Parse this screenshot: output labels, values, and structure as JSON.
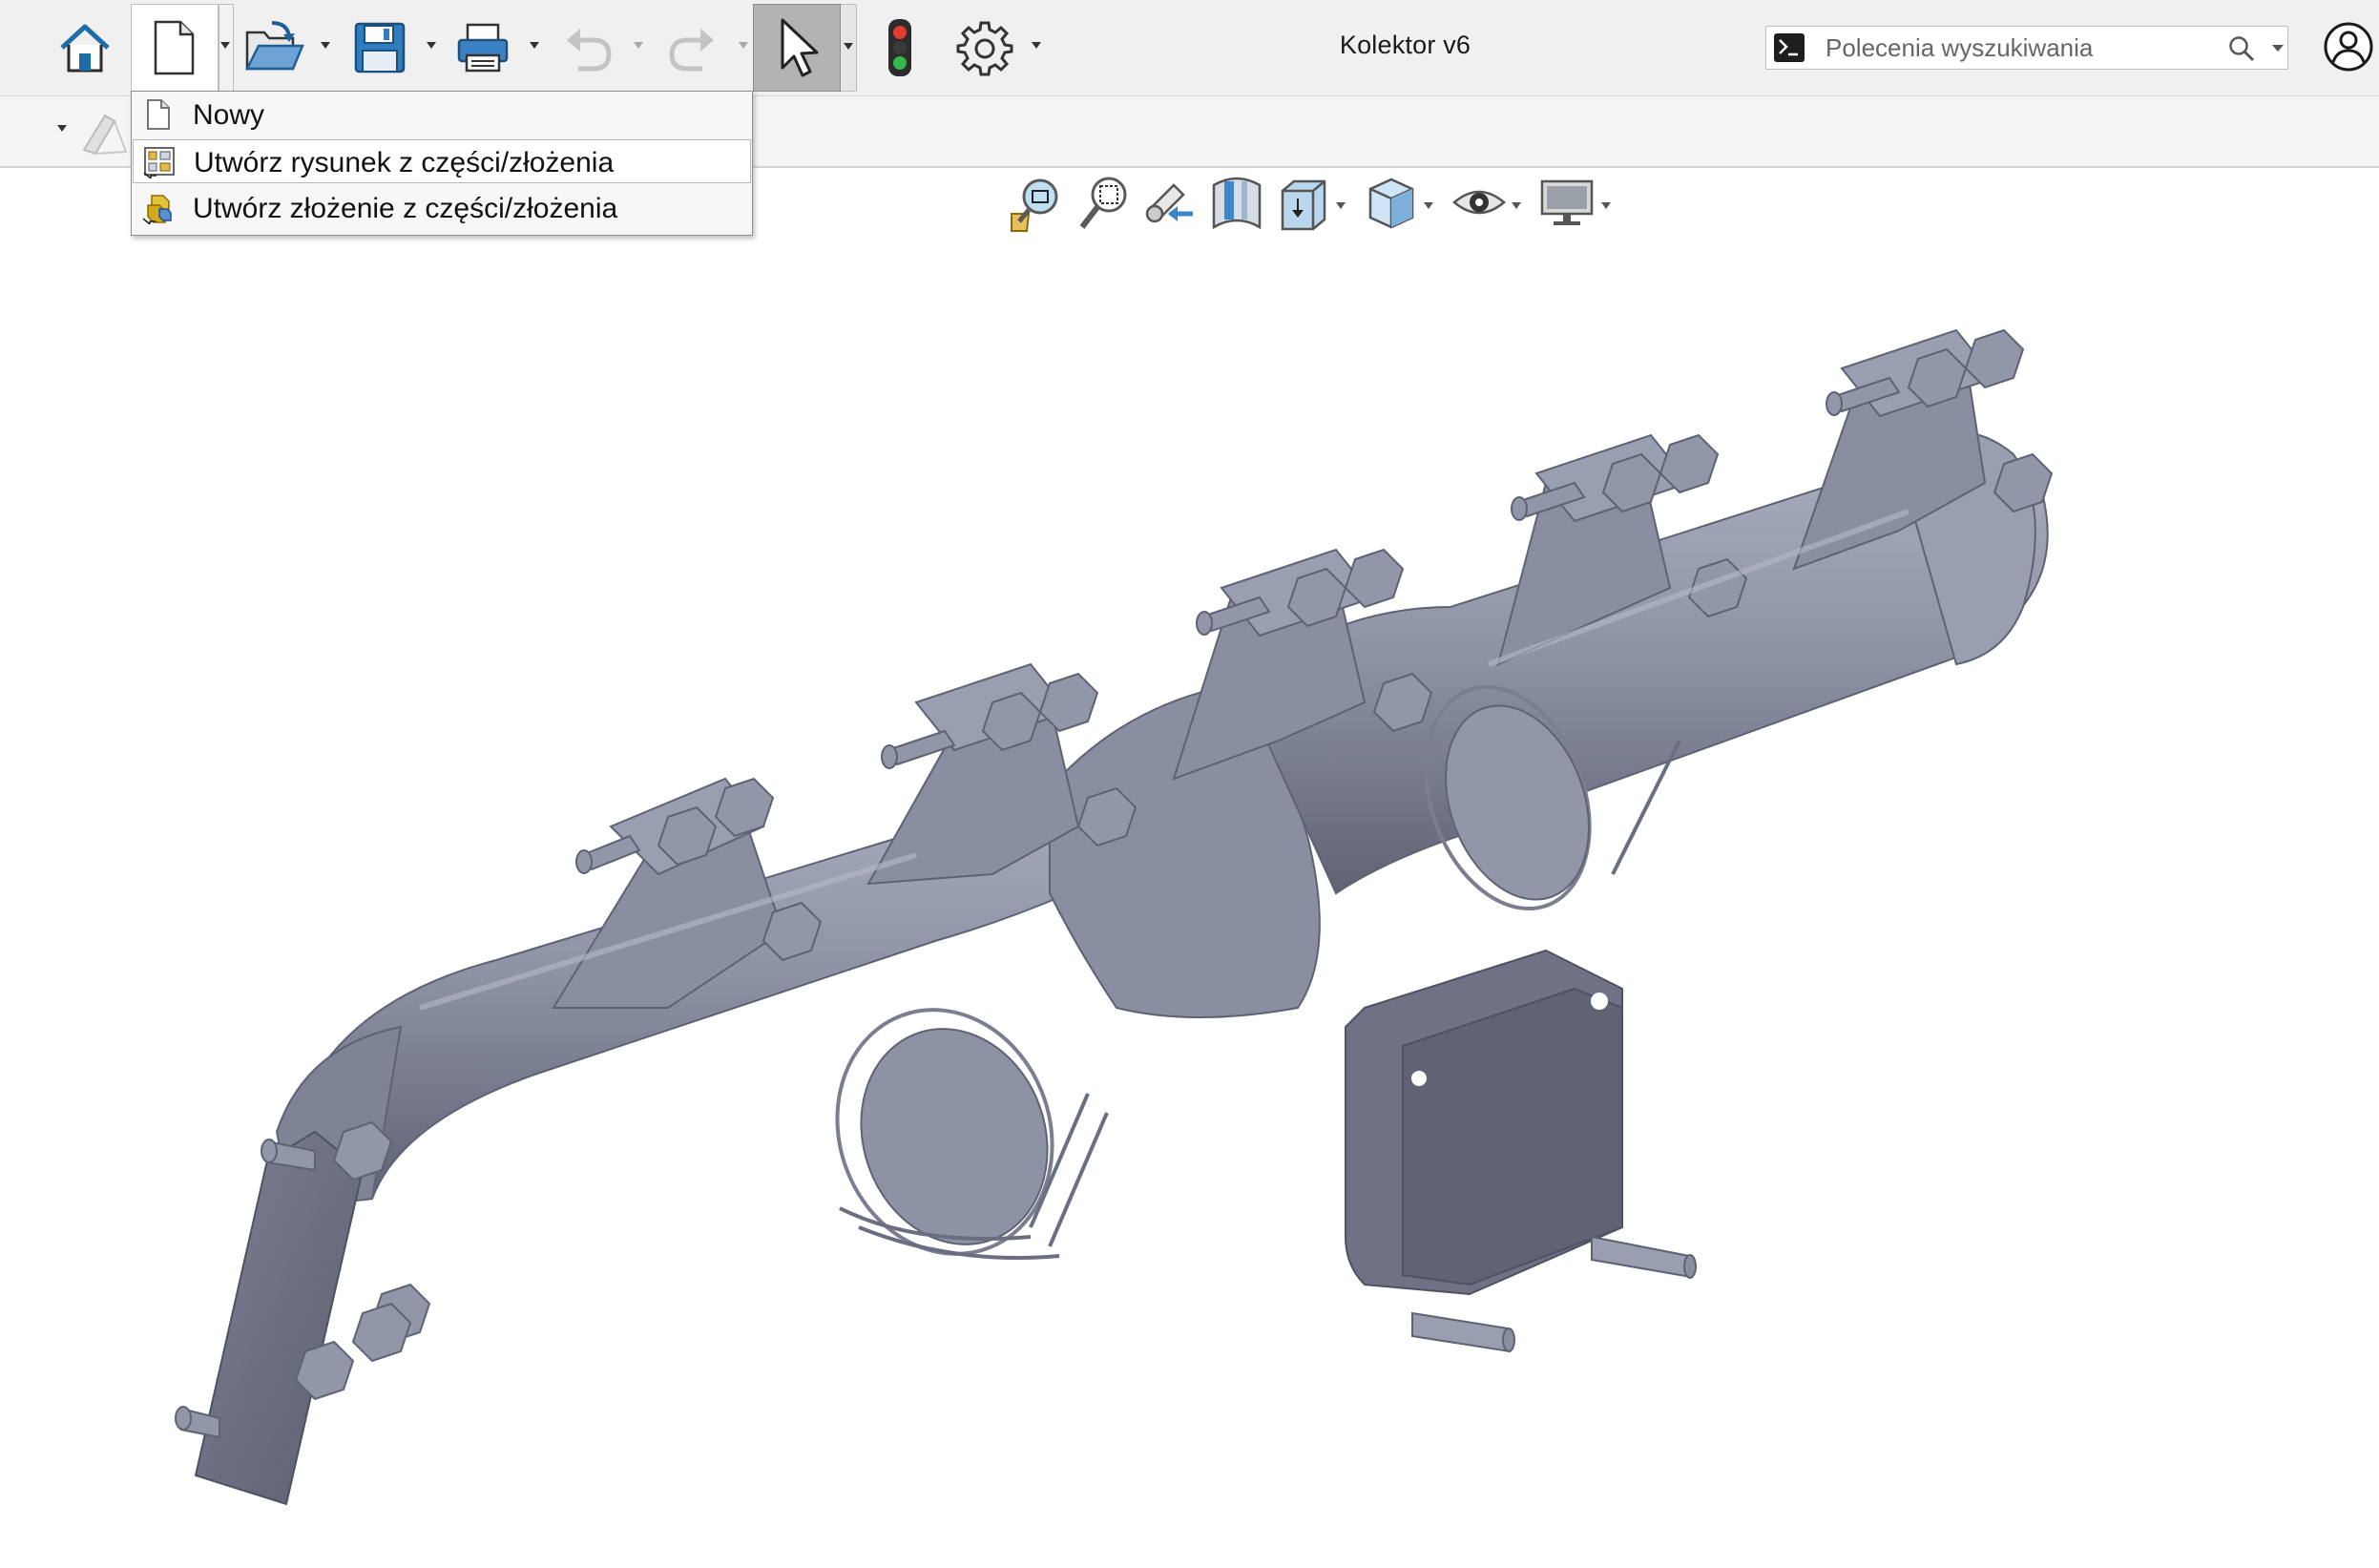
{
  "window": {
    "document_title": "Kolektor v6"
  },
  "toolbar": {
    "buttons": [
      {
        "name": "home",
        "icon": "home-icon"
      },
      {
        "name": "new",
        "icon": "new-document-icon"
      },
      {
        "name": "open",
        "icon": "open-folder-icon"
      },
      {
        "name": "save",
        "icon": "save-disk-icon"
      },
      {
        "name": "print",
        "icon": "printer-icon"
      },
      {
        "name": "undo",
        "icon": "undo-icon",
        "disabled": true
      },
      {
        "name": "redo",
        "icon": "redo-icon",
        "disabled": true
      },
      {
        "name": "select",
        "icon": "cursor-arrow-icon",
        "active": true
      },
      {
        "name": "rebuild",
        "icon": "traffic-light-icon"
      },
      {
        "name": "options",
        "icon": "gear-icon"
      }
    ]
  },
  "search": {
    "placeholder": "Polecenia wyszukiwania"
  },
  "new_menu": {
    "items": [
      {
        "label": "Nowy",
        "icon": "blank-document-icon"
      },
      {
        "label": "Utwórz rysunek z części/złożenia",
        "icon": "make-drawing-icon",
        "highlighted": true
      },
      {
        "label": "Utwórz złożenie z części/złożenia",
        "icon": "make-assembly-icon"
      }
    ]
  },
  "view_toolbar": {
    "tools": [
      {
        "name": "zoom-to-fit",
        "icon": "zoom-fit-icon"
      },
      {
        "name": "zoom-to-area",
        "icon": "zoom-area-icon"
      },
      {
        "name": "previous-view",
        "icon": "previous-view-icon"
      },
      {
        "name": "section-view",
        "icon": "section-view-icon"
      },
      {
        "name": "view-orientation",
        "icon": "view-orientation-icon",
        "dropdown": true
      },
      {
        "name": "display-style",
        "icon": "display-style-cube-icon",
        "dropdown": true
      },
      {
        "name": "hide-show-items",
        "icon": "eye-icon",
        "dropdown": true
      },
      {
        "name": "view-settings",
        "icon": "monitor-icon",
        "dropdown": true
      }
    ]
  },
  "colors": {
    "model_face": "#8c90a3",
    "model_dark": "#5e6272",
    "model_light": "#a7abbd",
    "toolbar_bg": "#f0f0f0",
    "active_button": "#b3b3b3",
    "accent_blue": "#1f6fb2"
  }
}
